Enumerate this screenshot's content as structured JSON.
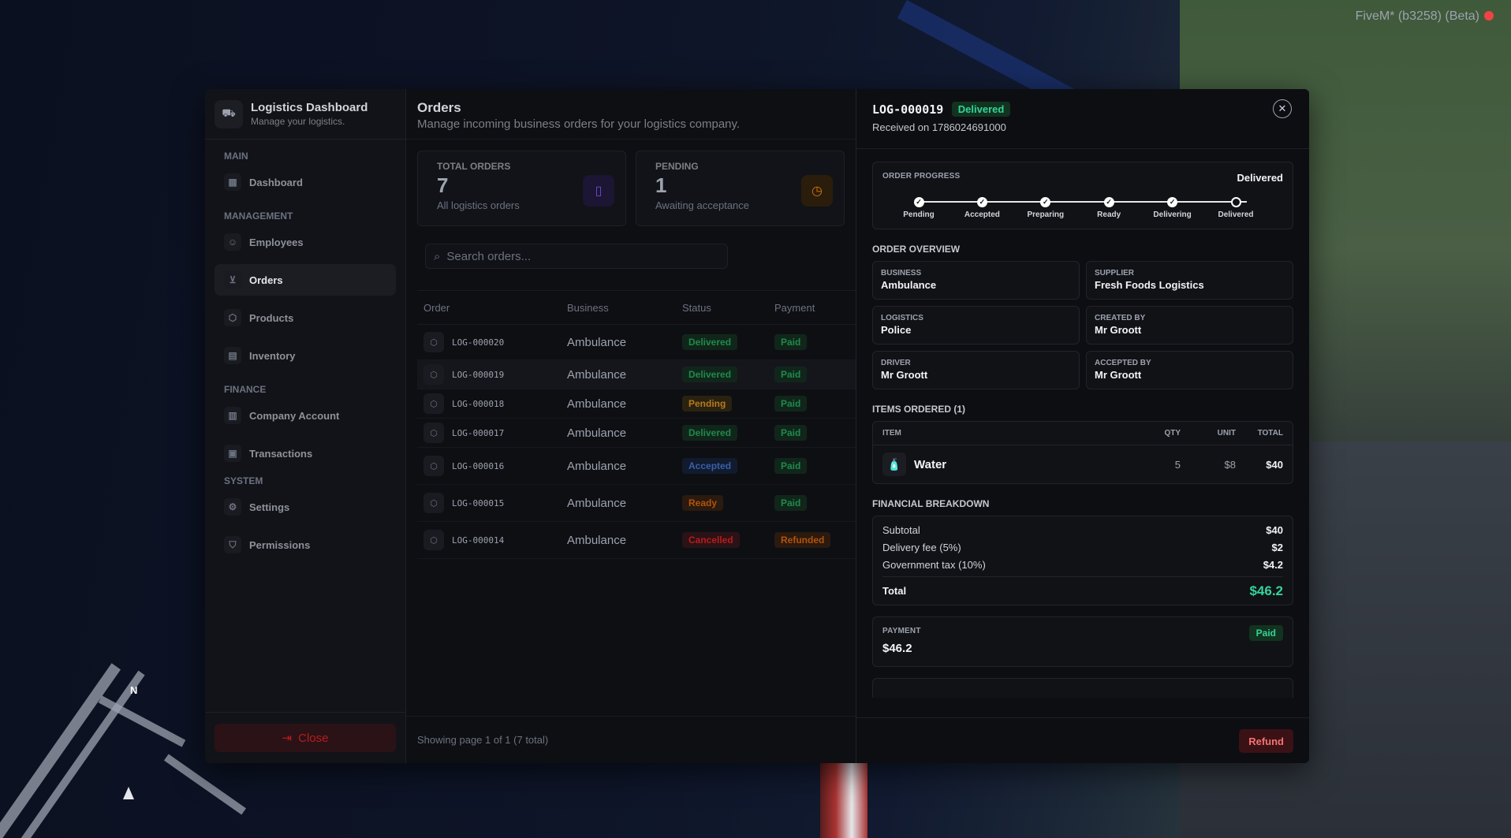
{
  "overlay": {
    "fivem_label": "FiveM* (b3258) (Beta)",
    "compass": "N"
  },
  "sidebar": {
    "title": "Logistics Dashboard",
    "subtitle": "Manage your logistics.",
    "sections": [
      {
        "label": "MAIN"
      },
      {
        "label": "MANAGEMENT"
      },
      {
        "label": "FINANCE"
      },
      {
        "label": "SYSTEM"
      }
    ],
    "items": [
      {
        "label": "Dashboard",
        "icon": "dashboard-icon"
      },
      {
        "label": "Employees",
        "icon": "users-icon"
      },
      {
        "label": "Orders",
        "icon": "cart-icon"
      },
      {
        "label": "Products",
        "icon": "box-icon"
      },
      {
        "label": "Inventory",
        "icon": "warehouse-icon"
      },
      {
        "label": "Company Account",
        "icon": "bank-icon"
      },
      {
        "label": "Transactions",
        "icon": "receipt-icon"
      },
      {
        "label": "Settings",
        "icon": "gear-icon"
      },
      {
        "label": "Permissions",
        "icon": "shield-icon"
      }
    ],
    "close_label": "Close"
  },
  "main": {
    "title": "Orders",
    "subtitle": "Manage incoming business orders for your logistics company.",
    "stats": [
      {
        "label": "TOTAL ORDERS",
        "value": "7",
        "sub": "All logistics orders",
        "icon": "clipboard-icon",
        "color": "#6d4bd6"
      },
      {
        "label": "PENDING",
        "value": "1",
        "sub": "Awaiting acceptance",
        "icon": "clock-icon",
        "color": "#d97706"
      }
    ],
    "search_placeholder": "Search orders...",
    "columns": [
      "Order",
      "Business",
      "Status",
      "Payment"
    ],
    "rows": [
      {
        "order": "LOG-000020",
        "business": "Ambulance",
        "status": "Delivered",
        "payment": "Paid"
      },
      {
        "order": "LOG-000019",
        "business": "Ambulance",
        "status": "Delivered",
        "payment": "Paid"
      },
      {
        "order": "LOG-000018",
        "business": "Ambulance",
        "status": "Pending",
        "payment": "Paid"
      },
      {
        "order": "LOG-000017",
        "business": "Ambulance",
        "status": "Delivered",
        "payment": "Paid"
      },
      {
        "order": "LOG-000016",
        "business": "Ambulance",
        "status": "Accepted",
        "payment": "Paid"
      },
      {
        "order": "LOG-000015",
        "business": "Ambulance",
        "status": "Ready",
        "payment": "Paid"
      },
      {
        "order": "LOG-000014",
        "business": "Ambulance",
        "status": "Cancelled",
        "payment": "Refunded"
      }
    ],
    "footer": "Showing page 1 of 1 (7 total)"
  },
  "detail": {
    "order_id": "LOG-000019",
    "status_badge": "Delivered",
    "received": "Received on 1786024691000",
    "progress_label": "ORDER PROGRESS",
    "progress_status": "Delivered",
    "steps": [
      "Pending",
      "Accepted",
      "Preparing",
      "Ready",
      "Delivering",
      "Delivered"
    ],
    "overview_title": "ORDER OVERVIEW",
    "overview": [
      {
        "label": "BUSINESS",
        "value": "Ambulance"
      },
      {
        "label": "SUPPLIER",
        "value": "Fresh Foods Logistics"
      },
      {
        "label": "LOGISTICS",
        "value": "Police"
      },
      {
        "label": "CREATED BY",
        "value": "Mr Groott"
      },
      {
        "label": "DRIVER",
        "value": "Mr Groott"
      },
      {
        "label": "ACCEPTED BY",
        "value": "Mr Groott"
      }
    ],
    "items_title": "ITEMS ORDERED (1)",
    "items_columns": {
      "item": "ITEM",
      "qty": "QTY",
      "unit": "UNIT",
      "total": "TOTAL"
    },
    "items": [
      {
        "name": "Water",
        "qty": "5",
        "unit": "$8",
        "total": "$40",
        "icon": "water-bottle-icon"
      }
    ],
    "financial_title": "FINANCIAL BREAKDOWN",
    "financial": [
      {
        "label": "Subtotal",
        "value": "$40"
      },
      {
        "label": "Delivery fee (5%)",
        "value": "$2"
      },
      {
        "label": "Government tax (10%)",
        "value": "$4.2"
      }
    ],
    "total_label": "Total",
    "total_value": "$46.2",
    "payment_label": "PAYMENT",
    "payment_badge": "Paid",
    "payment_value": "$46.2",
    "refund_label": "Refund"
  }
}
